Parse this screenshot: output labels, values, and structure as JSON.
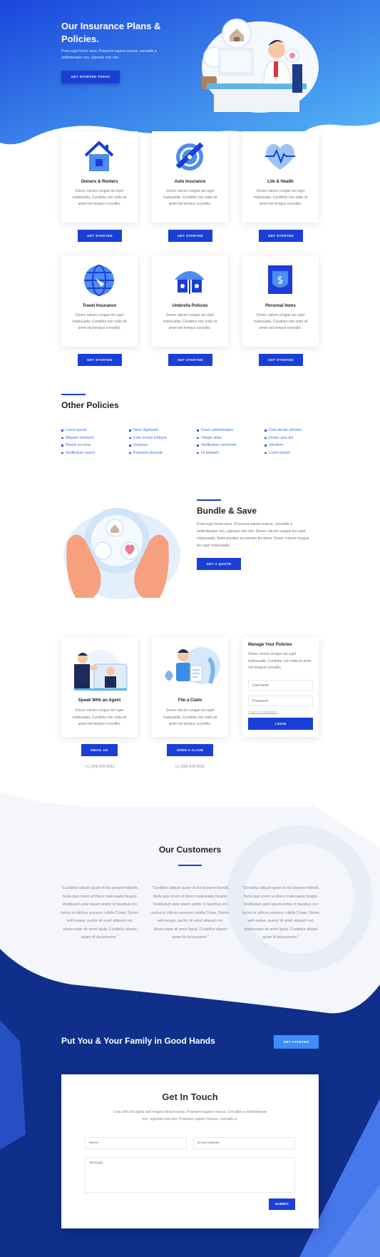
{
  "hero": {
    "title": "Our Insurance Plans & Policies.",
    "text": "Proin eget tortor risus. Praesent sapien massa, convallis a pellentesque nec, egestas non nisi.",
    "button": "Get Started Today"
  },
  "plans": [
    {
      "title": "Owners & Renters",
      "icon": "house-icon",
      "desc": "Donec rutrum congue leo eget malesuada. Curabitur non nulla sit amet nisl tempus convallis.",
      "button": "Get Started"
    },
    {
      "title": "Auto Insurance",
      "icon": "car-shield-icon",
      "desc": "Donec rutrum congue leo eget malesuada. Curabitur non nulla sit amet nisl tempus convallis.",
      "button": "Get Started"
    },
    {
      "title": "Life & Health",
      "icon": "heart-pulse-icon",
      "desc": "Donec rutrum congue leo eget malesuada. Curabitur non nulla sit amet nisl tempus convallis.",
      "button": "Get Started"
    },
    {
      "title": "Travel Insurance",
      "icon": "globe-icon",
      "desc": "Donec rutrum congue leo eget malesuada. Curabitur non nulla sit amet nisl tempus convallis.",
      "button": "Get Started"
    },
    {
      "title": "Umbrella Policies",
      "icon": "umbrella-icon",
      "desc": "Donec rutrum congue leo eget malesuada. Curabitur non nulla sit amet nisl tempus convallis.",
      "button": "Get Started"
    },
    {
      "title": "Personal Items",
      "icon": "money-shield-icon",
      "desc": "Donec rutrum congue leo eget malesuada. Curabitur non nulla sit amet nisl tempus convallis.",
      "button": "Get Started"
    }
  ],
  "other": {
    "heading": "Other Policies",
    "columns": [
      [
        "Lorem ipsum",
        "Aliquam tincidunt",
        "Mauris eu risus",
        "Vestibulum auctor"
      ],
      [
        "Nunc dignissim",
        "Cras ornare tristique",
        "Vivamus",
        "Praesent placerat"
      ],
      [
        "Fusce pellentesque",
        "Integer vitae",
        "Vestibulum commodo",
        "Ut aliquam"
      ],
      [
        "Cras iaculis ultricies",
        "Donec quis dui",
        "Interdum",
        "Lorem ipsum"
      ]
    ]
  },
  "bundle": {
    "heading": "Bundle & Save",
    "text": "Proin eget tortor risus. Praesent sapien massa, convallis a pellentesque nec, egestas non nisi. Donec rutrum congue leo eget malesuada. Nulla porttitor accumsan tincidunt. Donec rutrum congue leo eget malesuada.",
    "button": "Get A Quote"
  },
  "contact": {
    "agent": {
      "title": "Speak With an Agent",
      "desc": "Donec rutrum congue leo eget malesuada. Curabitur non nulla sit amet nisl tempus convallis.",
      "button": "Email Us",
      "phone": "+1 (343) 678-9012"
    },
    "claim": {
      "title": "File a Claim",
      "desc": "Donec rutrum congue leo eget malesuada. Curabitur non nulla sit amet nisl tempus convallis.",
      "button": "Open A Claim",
      "phone": "+1 (343) 678-9023"
    },
    "manage": {
      "title": "Manage Your Policies",
      "desc": "Donec rutrum congue leo eget malesuada. Curabitur non nulla sit amet nisl tempus convallis.",
      "username_placeholder": "Username",
      "password_placeholder": "Password",
      "forgot": "Forgot your password?",
      "button": "Login"
    }
  },
  "customers": {
    "heading": "Our Customers",
    "quotes": [
      "\"Curabitur aliquet quam id dui posuere blandit. Nulla quis lorem ut libero malesuada feugiat. Vestibulum ante ipsum primis in faucibus orci luctus et ultrices posuere cubilia Curae; Donec velit neque, auctor sit amet aliquam vel, ullamcorper sit amet ligula. Curabitur aliquet quam id dui posuere.\"",
      "\"Curabitur aliquet quam id dui posuere blandit. Nulla quis lorem ut libero malesuada feugiat. Vestibulum ante ipsum primis in faucibus orci luctus et ultrices posuere cubilia Curae; Donec velit neque, auctor sit amet aliquam vel, ullamcorper sit amet ligula. Curabitur aliquet quam id dui posuere.\"",
      "\"Curabitur aliquet quam id dui posuere blandit. Nulla quis lorem ut libero malesuada feugiat. Vestibulum ante ipsum primis in faucibus orci luctus et ultrices posuere cubilia Curae; Donec velit neque, auctor sit amet aliquam vel, ullamcorper sit amet ligula. Curabitur aliquet quam id dui posuere.\""
    ]
  },
  "family": {
    "heading": "Put You & Your Family in Good Hands",
    "button": "Get Started"
  },
  "touch": {
    "heading": "Get In Touch",
    "text": "Cras ultricies ligula sed magna dictum porta. Praesent sapien massa, convallis a pellentesque nec, egestas non nisi. Praesent sapien massa, convallis a.",
    "name_placeholder": "Name",
    "email_placeholder": "Email Address",
    "message_placeholder": "Message",
    "button": "Submit"
  },
  "colors": {
    "primary": "#1a3fd6",
    "hero_top": "#1e4fe0",
    "hero_bottom": "#4fb0f5",
    "footer": "#0f2f8a",
    "link": "#3c73e8"
  }
}
